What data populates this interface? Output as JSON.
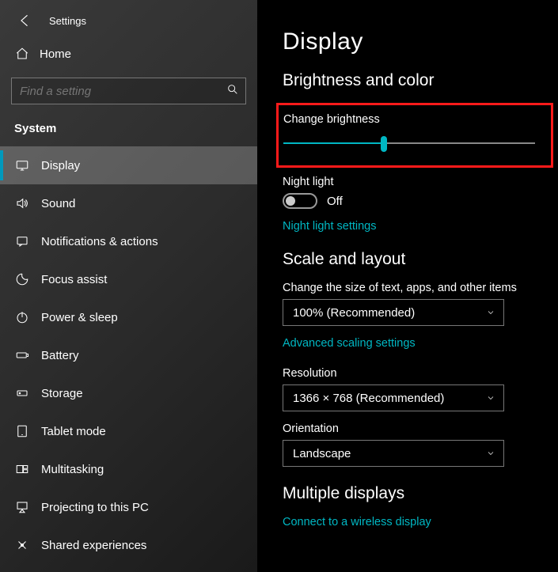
{
  "header": {
    "title": "Settings"
  },
  "home_label": "Home",
  "search": {
    "placeholder": "Find a setting"
  },
  "category": "System",
  "nav": {
    "items": [
      {
        "label": "Display"
      },
      {
        "label": "Sound"
      },
      {
        "label": "Notifications & actions"
      },
      {
        "label": "Focus assist"
      },
      {
        "label": "Power & sleep"
      },
      {
        "label": "Battery"
      },
      {
        "label": "Storage"
      },
      {
        "label": "Tablet mode"
      },
      {
        "label": "Multitasking"
      },
      {
        "label": "Projecting to this PC"
      },
      {
        "label": "Shared experiences"
      }
    ]
  },
  "main": {
    "title": "Display",
    "brightness_section": "Brightness and color",
    "brightness_label": "Change brightness",
    "brightness_percent": 40,
    "night_light_label": "Night light",
    "night_light_state": "Off",
    "night_light_link": "Night light settings",
    "scale_section": "Scale and layout",
    "scale_label": "Change the size of text, apps, and other items",
    "scale_value": "100% (Recommended)",
    "advanced_scaling_link": "Advanced scaling settings",
    "resolution_label": "Resolution",
    "resolution_value": "1366 × 768 (Recommended)",
    "orientation_label": "Orientation",
    "orientation_value": "Landscape",
    "multi_section": "Multiple displays",
    "wireless_link": "Connect to a wireless display"
  }
}
